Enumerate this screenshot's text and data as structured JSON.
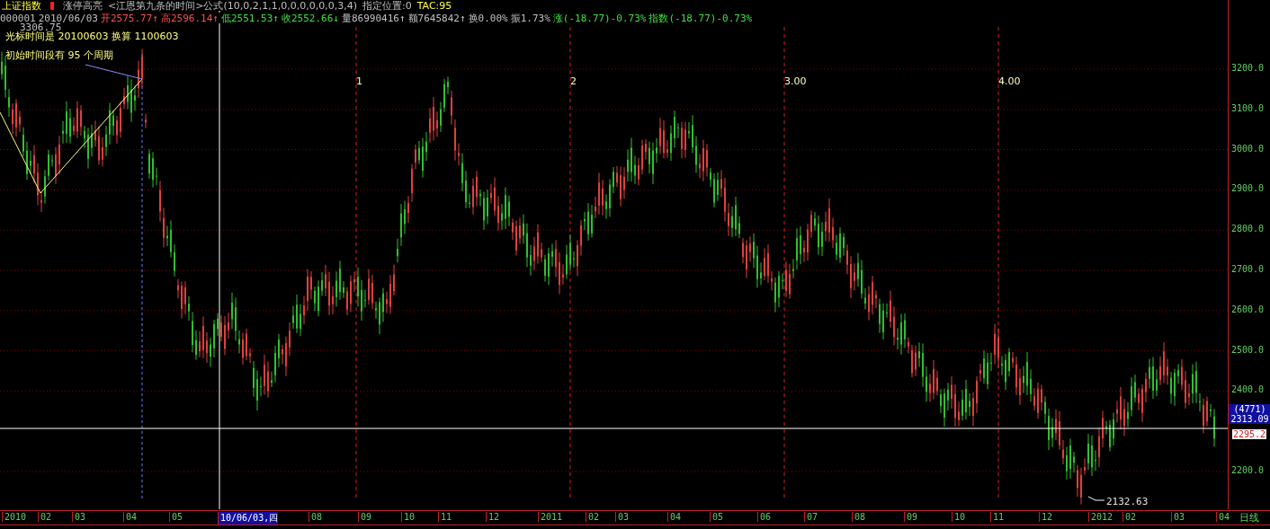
{
  "header": {
    "title": "上证指数",
    "mode": "涨停高亮",
    "formula": "<江恩第九条的时间>公式(10,0,2,1,1,0,0,0,0,0,0,3,4)",
    "position": "指定位置:0",
    "tac": "TAC:95"
  },
  "quote": [
    {
      "text": "000001",
      "color": "#c0c0c0"
    },
    {
      "text": "2010/06/03",
      "color": "#c0c0c0"
    },
    {
      "text": "开2575.77↑",
      "color": "#ff5050"
    },
    {
      "text": "高2596.14↑",
      "color": "#ff5050"
    },
    {
      "text": "低2551.53↑",
      "color": "#40e040"
    },
    {
      "text": "收2552.66↓",
      "color": "#40e040"
    },
    {
      "text": "量86990416↑",
      "color": "#c0c0c0"
    },
    {
      "text": "额7645842↑",
      "color": "#c0c0c0"
    },
    {
      "text": "换0.00%",
      "color": "#c0c0c0"
    },
    {
      "text": "振1.73%",
      "color": "#c0c0c0"
    },
    {
      "text": "涨(-18.77)-0.73%",
      "color": "#40e040"
    },
    {
      "text": "指数(-18.77)-0.73%",
      "color": "#40e040"
    }
  ],
  "chart_info": {
    "high_label": "3306.75",
    "cursor_time": "光标时间是 20100603 换算 1100603",
    "initial_period": "初始时间段有 95 个周期",
    "low_label": "2132.63"
  },
  "cycles": [
    "1",
    "2",
    "3.00",
    "4.00"
  ],
  "price_axis": [
    "3200.0",
    "3100.0",
    "3000.0",
    "2900.0",
    "2800.0",
    "2700.0",
    "2600.0",
    "2500.0",
    "2400.0",
    "2200.0"
  ],
  "cursor_box": {
    "count": "(4771)",
    "price": "2313.09"
  },
  "last_price": "2295.2",
  "time_axis": [
    "2010",
    "02",
    "03",
    "04",
    "05",
    "10/06/03,四",
    "08",
    "09",
    "10",
    "11",
    "12",
    "2011",
    "02",
    "03",
    "04",
    "05",
    "06",
    "07",
    "08",
    "09",
    "10",
    "11",
    "12",
    "2012",
    "02",
    "03",
    "04"
  ],
  "period": "日线"
}
